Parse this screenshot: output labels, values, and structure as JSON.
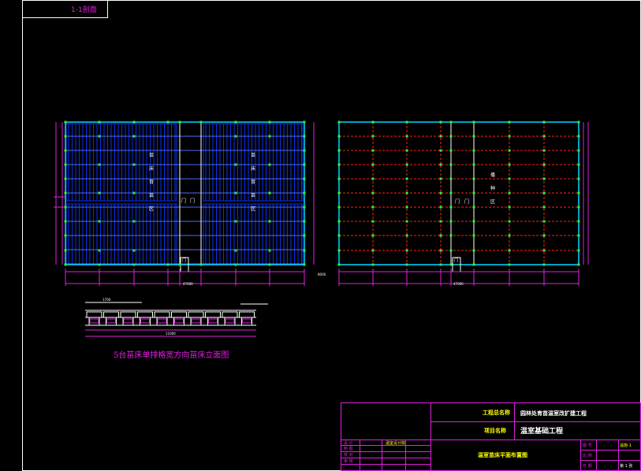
{
  "drawing": {
    "corner_label": "1-1剖面",
    "left_plan": {
      "zone_chars": [
        "苗",
        "床",
        "育",
        "苗",
        "区"
      ],
      "door_chars": [
        "门",
        "门"
      ],
      "door_small": "门",
      "total_dim": "47000"
    },
    "right_plan": {
      "zone_chars": [
        "播",
        "种",
        "区"
      ],
      "door_chars": [
        "门",
        "门"
      ],
      "door_small": "门",
      "total_dim": "47000"
    },
    "gap_dim": "8000",
    "elevation_title": "5台苗床单排格宽方向苗床立面图",
    "elevation_top_dim": "1700",
    "elevation_total_dim": "11000"
  },
  "title_block": {
    "project_general_label": "工程总名称",
    "project_general_value": "园林处育苗温室改扩建工程",
    "project_label": "项目名称",
    "project_value": "温室基础工程",
    "designer_label": "设 计",
    "designer_unit": "温室设计院",
    "drawing_name": "温室苗床平面布置图",
    "drawing_no_label": "图 号",
    "drawing_no": "温施-1",
    "scale_label": "比 例",
    "date_label": "日 期",
    "sheet_label": "第 1 张",
    "row_labels": [
      "设 计",
      "制 图",
      "校 对",
      "审 核"
    ]
  },
  "colors": {
    "frame": "#ffffff",
    "cyan": "#00d8ff",
    "blue_bed": "#0a2ff0",
    "red_grid": "#ff2020",
    "green_node": "#22ff22",
    "magenta": "#e020e0",
    "yellow": "#ffff00",
    "white": "#ffffff"
  }
}
